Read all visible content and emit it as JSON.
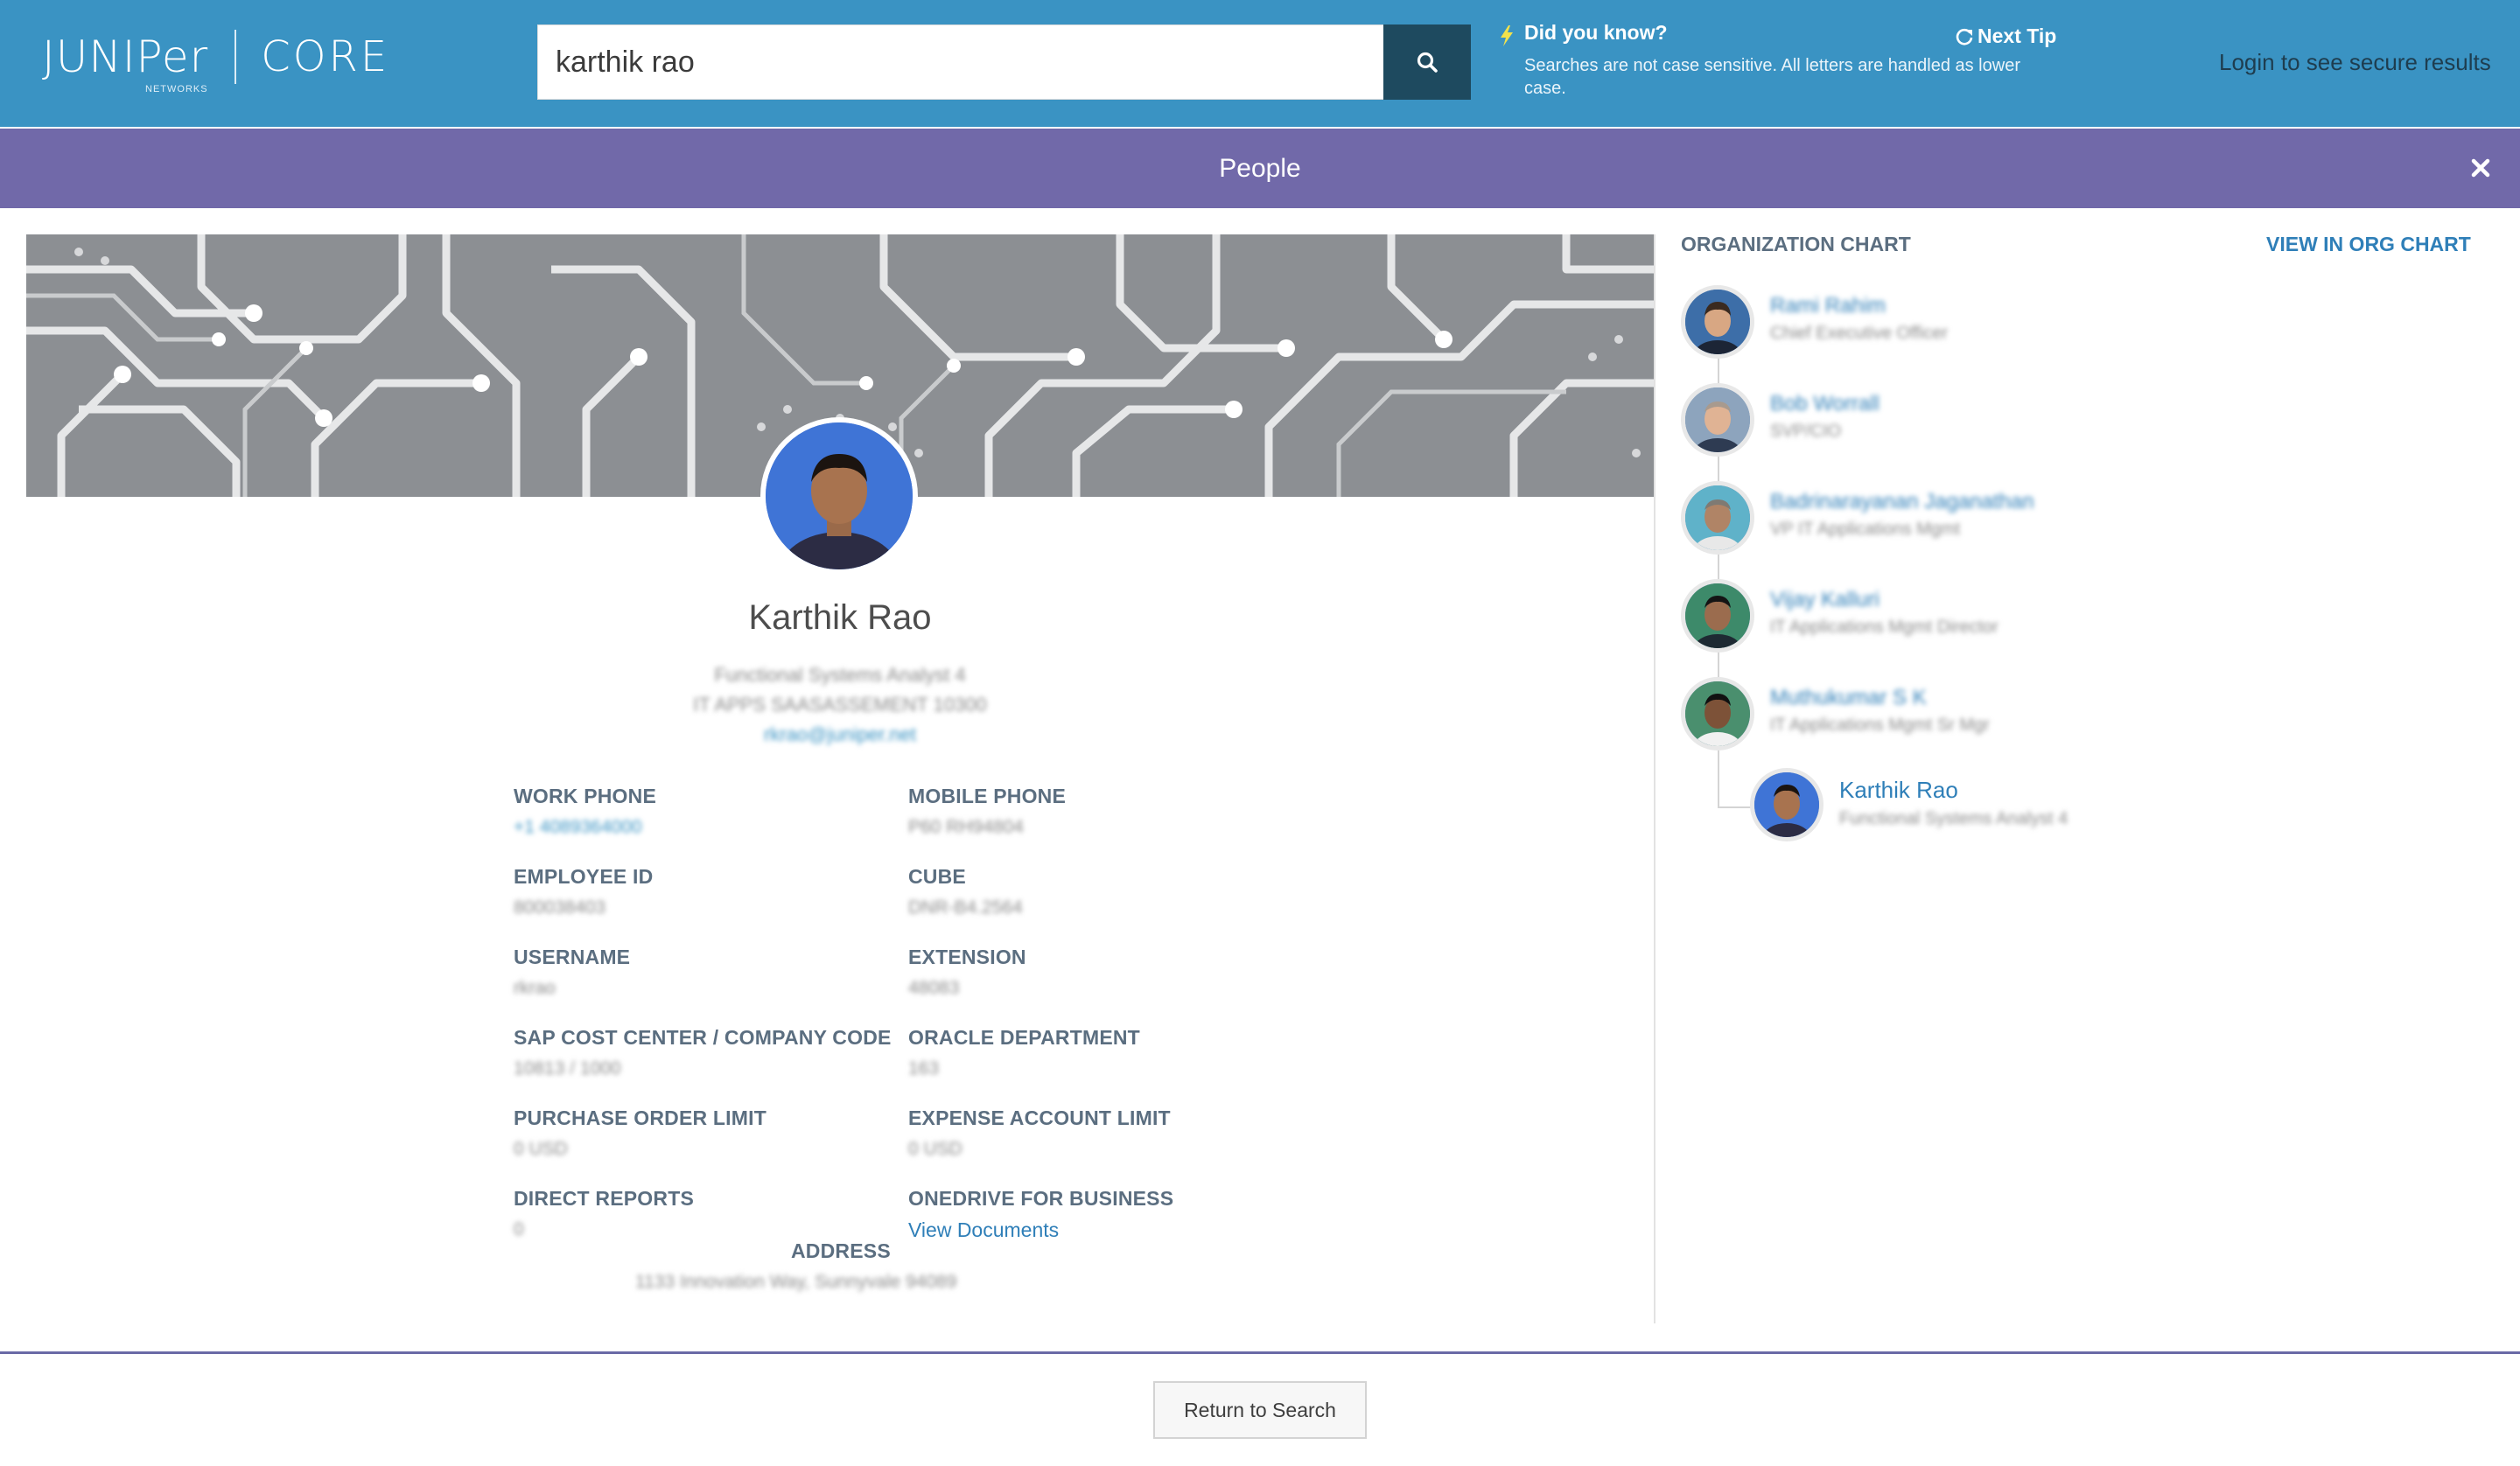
{
  "header": {
    "logo_text": "JUNIPer",
    "logo_sub": "NETWORKS",
    "product": "CORE",
    "search_value": "karthik rao",
    "tip_title": "Did you know?",
    "tip_text": "Searches are not case sensitive. All letters are handled as lower case.",
    "next_tip": "Next Tip",
    "login_link": "Login to see secure results"
  },
  "panel": {
    "title": "People"
  },
  "profile": {
    "name": "Karthik Rao",
    "title_line": "Functional Systems Analyst 4",
    "dept_line": "IT APPS SAASASSEMENT 10300",
    "email": "rkrao@juniper.net",
    "fields": {
      "work_phone_label": "WORK PHONE",
      "work_phone_value": "+1 4089364000",
      "mobile_phone_label": "MOBILE PHONE",
      "mobile_phone_value": "P60 RH94804",
      "employee_id_label": "EMPLOYEE ID",
      "employee_id_value": "800038403",
      "cube_label": "CUBE",
      "cube_value": "DNR-B4.2564",
      "username_label": "USERNAME",
      "username_value": "rkrao",
      "extension_label": "EXTENSION",
      "extension_value": "48083",
      "sap_label": "SAP COST CENTER / COMPANY CODE",
      "sap_value": "10813 / 1000",
      "oracle_label": "ORACLE DEPARTMENT",
      "oracle_value": "163",
      "po_label": "PURCHASE ORDER LIMIT",
      "po_value": "0 USD",
      "expense_label": "EXPENSE ACCOUNT LIMIT",
      "expense_value": "0 USD",
      "direct_reports_label": "DIRECT REPORTS",
      "direct_reports_value": "0",
      "onedrive_label": "ONEDRIVE FOR BUSINESS",
      "onedrive_link": "View Documents",
      "address_label": "ADDRESS",
      "address_value": "1133 Innovation Way, Sunnyvale 94089"
    }
  },
  "org_chart": {
    "title": "ORGANIZATION CHART",
    "view_link": "VIEW IN ORG CHART",
    "people": [
      {
        "name": "Rami Rahim",
        "role": "Chief Executive Officer"
      },
      {
        "name": "Bob Worrall",
        "role": "SVP/CIO"
      },
      {
        "name": "Badrinarayanan Jaganathan",
        "role": "VP IT Applications Mgmt"
      },
      {
        "name": "Vijay Kalluri",
        "role": "IT Applications Mgmt Director"
      },
      {
        "name": "Muthukumar S K",
        "role": "IT Applications Mgmt Sr Mgr"
      },
      {
        "name": "Karthik Rao",
        "role": "Functional Systems Analyst 4"
      }
    ]
  },
  "footer": {
    "return_button": "Return to Search"
  },
  "colors": {
    "header_bg": "#3a93c3",
    "people_bar_bg": "#7169a9",
    "link": "#2f7fb8",
    "search_button_bg": "#1e4a5f"
  }
}
